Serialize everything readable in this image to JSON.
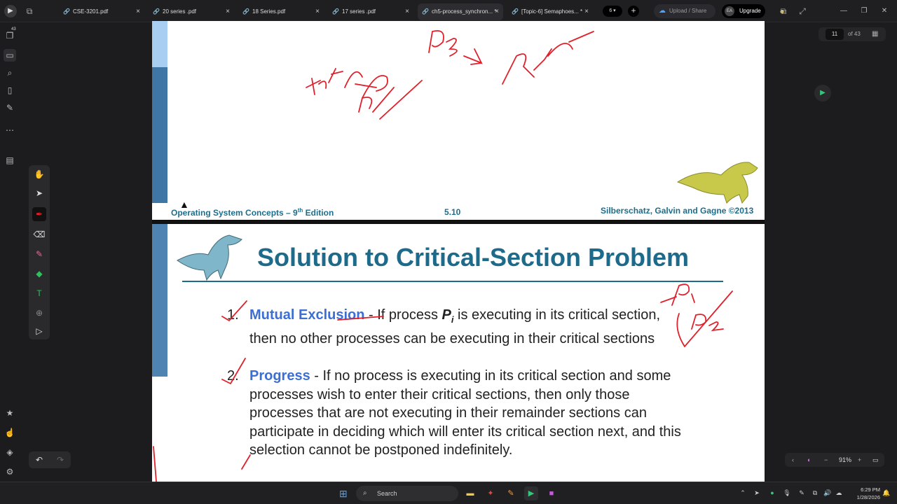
{
  "tabs": [
    {
      "label": "CSE-3201.pdf",
      "active": false
    },
    {
      "label": "20 series .pdf",
      "active": false
    },
    {
      "label": "18 Series.pdf",
      "active": false
    },
    {
      "label": "17 series .pdf",
      "active": false
    },
    {
      "label": "ch5-process_synchron... *",
      "active": true
    },
    {
      "label": "[Topic-6] Semaphoes... *",
      "active": false
    }
  ],
  "tab_count": "6",
  "upload_label": "Upload / Share",
  "upgrade_label": "Upgrade",
  "avatar_initials": "EA",
  "sidebar": {
    "badge_count": "43"
  },
  "page_indicator": {
    "current": "11",
    "of_label": "of 43"
  },
  "zoom": {
    "level": "91%"
  },
  "page1_footer": {
    "left_text": "Operating System Concepts – 9",
    "left_sup": "th",
    "left_tail": " Edition",
    "page_no": "5.10",
    "right_text": "Silberschatz, Galvin and Gagne ©2013"
  },
  "slide": {
    "title": "Solution to Critical-Section Problem",
    "items": [
      {
        "num": "1.",
        "term": "Mutual Exclusion",
        "before": " - If process ",
        "var": "P",
        "sub": "i",
        "after": " is executing in its critical section, then no other processes can be executing in their critical sections"
      },
      {
        "num": "2.",
        "term": "Progress",
        "text": " - If no process is executing in its critical section and some processes wish to enter their critical sections, then only those processes that are not executing in their remainder sections can participate in deciding which will enter its critical section next, and this selection cannot be postponed indefinitely."
      }
    ]
  },
  "taskbar": {
    "search_label": "Search",
    "time": "6:29 PM",
    "date": "1/28/2026"
  },
  "colors": {
    "accent_title": "#1d6a8a",
    "term_blue": "#3b6fd6",
    "ink_red": "#e0202a"
  }
}
